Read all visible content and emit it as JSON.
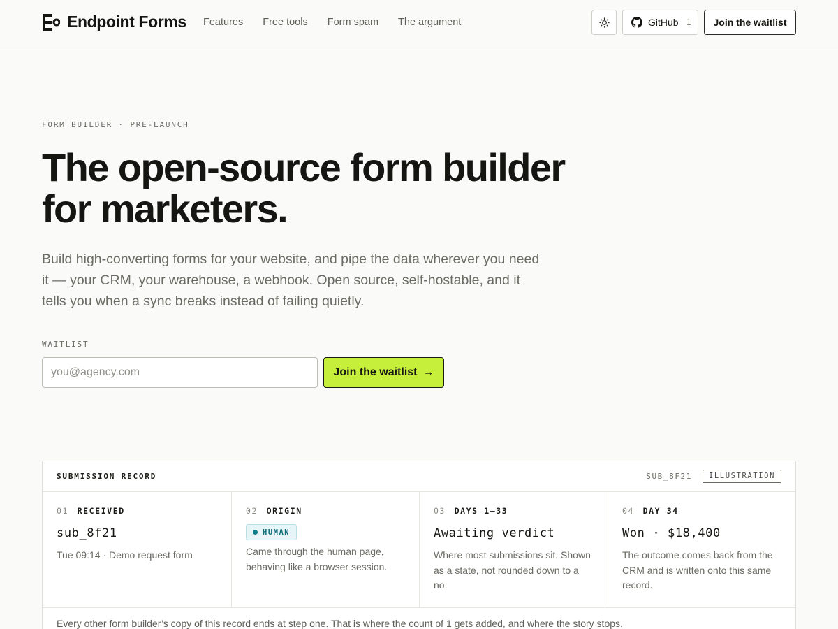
{
  "header": {
    "logo_text": "Endpoint Forms",
    "nav": [
      "Features",
      "Free tools",
      "Form spam",
      "The argument"
    ],
    "github_label": "GitHub",
    "github_count": "1",
    "cta_label": "Join the waitlist"
  },
  "hero": {
    "eyebrow": "FORM BUILDER · PRE-LAUNCH",
    "headline_line1": "The open-source form builder",
    "headline_line2": "for marketers.",
    "subhead": "Build high-converting forms for your website, and pipe the data wherever you need it — your CRM, your warehouse, a webhook. Open source, self-hostable, and it tells you when a sync breaks instead of failing quietly.",
    "waitlist_label": "WAITLIST",
    "email_placeholder": "you@agency.com",
    "cta_label": "Join the waitlist",
    "cta_arrow": "→"
  },
  "record": {
    "title": "SUBMISSION RECORD",
    "id": "SUB_8F21",
    "tag": "ILLUSTRATION",
    "steps": [
      {
        "num": "01",
        "label": "RECEIVED",
        "value": "sub_8f21",
        "desc": "Tue 09:14 · Demo request form"
      },
      {
        "num": "02",
        "label": "ORIGIN",
        "badge": "HUMAN",
        "desc": "Came through the human page, behaving like a browser session."
      },
      {
        "num": "03",
        "label": "DAYS 1–33",
        "value": "Awaiting verdict",
        "desc": "Where most submissions sit. Shown as a state, not rounded down to a no."
      },
      {
        "num": "04",
        "label": "DAY 34",
        "value": "Won · $18,400",
        "desc": "The outcome comes back from the CRM and is written onto this same record."
      }
    ],
    "footer": "Every other form builder’s copy of this record ends at step one. That is where the count of 1 gets added, and where the story stops."
  },
  "colors": {
    "background": "#fafaf8",
    "accent": "#c5ef3b",
    "badge_bg": "#e6f5f7",
    "badge_text": "#0e6e7a"
  },
  "icons": {
    "theme": "sun-icon",
    "github": "github-icon",
    "arrow": "arrow-right-icon"
  }
}
